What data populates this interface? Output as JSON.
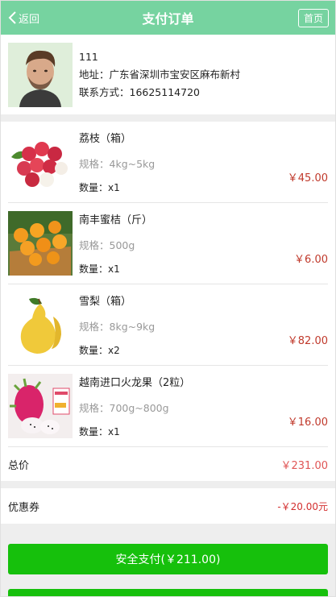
{
  "header": {
    "back_label": "返回",
    "title": "支付订单",
    "home_label": "首页"
  },
  "address": {
    "name": "111",
    "address": "地址：广东省深圳市宝安区麻布新村",
    "phone": "联系方式：16625114720"
  },
  "products": [
    {
      "name": "荔枝（箱）",
      "spec": "规格：4kg~5kg",
      "qty": "数量：x1",
      "price": "￥45.00",
      "image": "lychee"
    },
    {
      "name": "南丰蜜桔（斤）",
      "spec": "规格：500g",
      "qty": "数量：x1",
      "price": "￥6.00",
      "image": "tangerine"
    },
    {
      "name": "雪梨（箱）",
      "spec": "规格：8kg~9kg",
      "qty": "数量：x2",
      "price": "￥82.00",
      "image": "pear"
    },
    {
      "name": "越南进口火龙果（2粒）",
      "spec": "规格：700g~800g",
      "qty": "数量：x1",
      "price": "￥16.00",
      "image": "dragonfruit"
    }
  ],
  "total": {
    "label": "总价",
    "value": "￥231.00"
  },
  "coupon": {
    "label": "优惠券",
    "value": "-￥20.00元"
  },
  "pay_button": "安全支付(￥211.00)",
  "colors": {
    "header": "#76d3a0",
    "pay": "#16c00c",
    "price": "#c0392b"
  }
}
